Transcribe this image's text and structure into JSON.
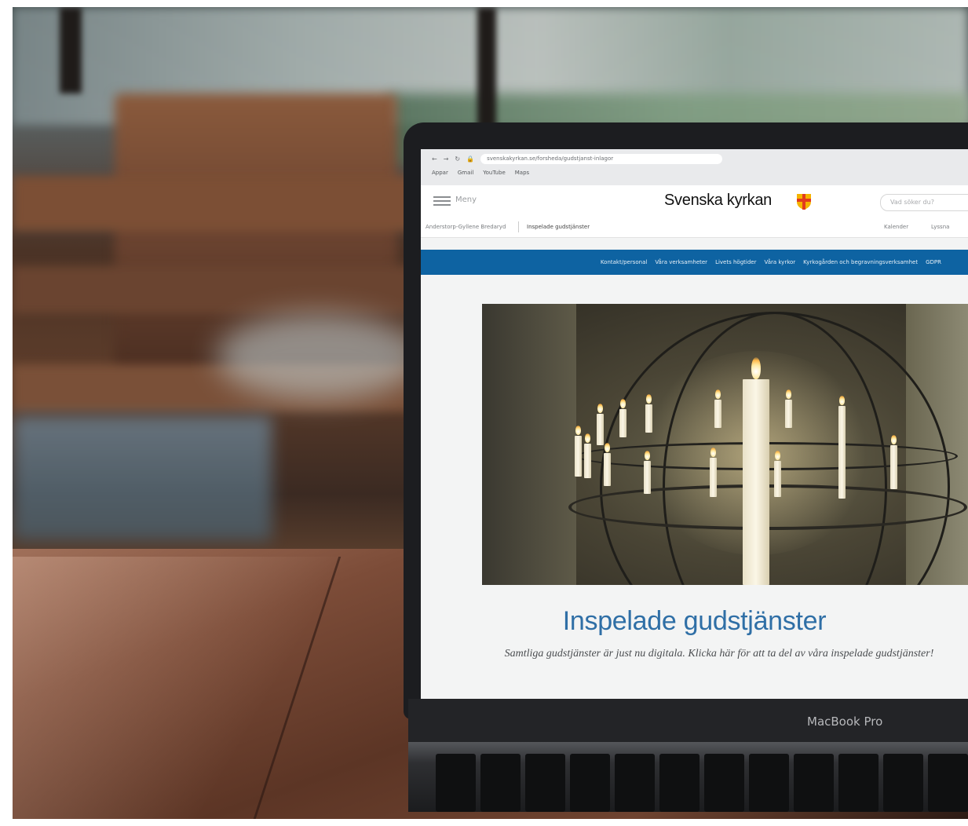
{
  "browser": {
    "url": "svenskakyrkan.se/forsheda/gudstjanst-inlagor",
    "bookmarks": [
      "Appar",
      "Gmail",
      "YouTube",
      "Maps"
    ]
  },
  "site": {
    "menu_label": "Meny",
    "logo_text": "Svenska kyrkan",
    "search_placeholder": "Vad söker du?",
    "breadcrumb_parent": "Anderstorp-Gyllene Bredaryd",
    "breadcrumb_current": "Inspelade gudstjänster",
    "utility_calendar": "Kalender",
    "utility_listen": "Lyssna"
  },
  "nav": {
    "items": [
      "Kontakt/personal",
      "Våra verksamheter",
      "Livets högtider",
      "Våra kyrkor",
      "Kyrkogården och begravningsverksamhet",
      "GDPR"
    ]
  },
  "hero": {
    "title": "Inspelade gudstjänster",
    "subtitle": "Samtliga gudstjänster är just nu digitala. Klicka här för att ta del av våra inspelade gudstjänster!"
  },
  "device": {
    "label": "MacBook Pro"
  },
  "colors": {
    "nav_blue": "#0e63a2",
    "title_blue": "#2f6fa6"
  }
}
